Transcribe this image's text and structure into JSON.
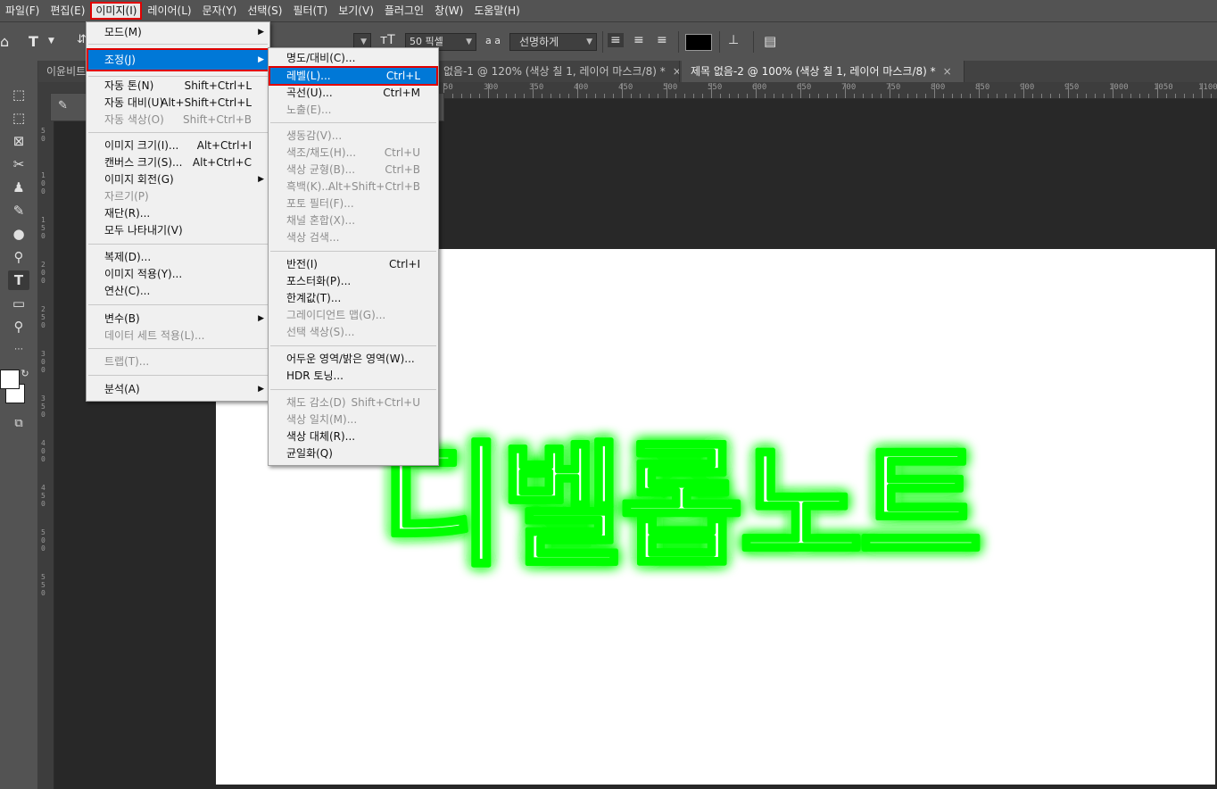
{
  "menubar": {
    "items": [
      "파일(F)",
      "편집(E)",
      "이미지(I)",
      "레이어(L)",
      "문자(Y)",
      "선택(S)",
      "필터(T)",
      "보기(V)",
      "플러그인",
      "창(W)",
      "도움말(H)"
    ]
  },
  "options": {
    "font_size": "50 픽셀",
    "aa_label": "a a",
    "antialias": "선명하게",
    "color_swatch": "#000000"
  },
  "tabs": [
    {
      "label": "이윤비트",
      "active": false
    },
    {
      "label": "없음-1 @ 120% (색상 칠 1, 레이어 마스크/8) *",
      "active": false
    },
    {
      "label": "제목 없음-2 @ 100% (색상 칠 1, 레이어 마스크/8) *",
      "active": true
    }
  ],
  "ruler": {
    "top_labels": [
      "50",
      "300",
      "350",
      "400",
      "450",
      "500",
      "550",
      "600",
      "650",
      "700",
      "750",
      "800",
      "850",
      "900",
      "950",
      "1000",
      "1050",
      "1100"
    ],
    "left_labels": [
      "50",
      "100",
      "150",
      "200",
      "250",
      "300",
      "350",
      "400",
      "450",
      "500",
      "550"
    ]
  },
  "image_menu": {
    "items": [
      {
        "label": "모드(M)",
        "shortcut": "",
        "submenu": true,
        "disabled": false
      },
      {
        "label": "조정(J)",
        "shortcut": "",
        "submenu": true,
        "disabled": false,
        "highlighted": true
      },
      {
        "label": "자동 톤(N)",
        "shortcut": "Shift+Ctrl+L",
        "disabled": false
      },
      {
        "label": "자동 대비(U)",
        "shortcut": "Alt+Shift+Ctrl+L",
        "disabled": false
      },
      {
        "label": "자동 색상(O)",
        "shortcut": "Shift+Ctrl+B",
        "disabled": true
      },
      {
        "label": "이미지 크기(I)...",
        "shortcut": "Alt+Ctrl+I",
        "disabled": false
      },
      {
        "label": "캔버스 크기(S)...",
        "shortcut": "Alt+Ctrl+C",
        "disabled": false
      },
      {
        "label": "이미지 회전(G)",
        "shortcut": "",
        "submenu": true,
        "disabled": false
      },
      {
        "label": "자르기(P)",
        "shortcut": "",
        "disabled": true
      },
      {
        "label": "재단(R)...",
        "shortcut": "",
        "disabled": false
      },
      {
        "label": "모두 나타내기(V)",
        "shortcut": "",
        "disabled": false
      },
      {
        "label": "복제(D)...",
        "shortcut": "",
        "disabled": false
      },
      {
        "label": "이미지 적용(Y)...",
        "shortcut": "",
        "disabled": false
      },
      {
        "label": "연산(C)...",
        "shortcut": "",
        "disabled": false
      },
      {
        "label": "변수(B)",
        "shortcut": "",
        "submenu": true,
        "disabled": false
      },
      {
        "label": "데이터 세트 적용(L)...",
        "shortcut": "",
        "disabled": true
      },
      {
        "label": "트랩(T)...",
        "shortcut": "",
        "disabled": true
      },
      {
        "label": "분석(A)",
        "shortcut": "",
        "submenu": true,
        "disabled": false
      }
    ]
  },
  "adjust_menu": {
    "items": [
      {
        "label": "명도/대비(C)...",
        "shortcut": "",
        "disabled": false
      },
      {
        "label": "레벨(L)...",
        "shortcut": "Ctrl+L",
        "disabled": false,
        "highlighted": true
      },
      {
        "label": "곡선(U)...",
        "shortcut": "Ctrl+M",
        "disabled": false
      },
      {
        "label": "노출(E)...",
        "shortcut": "",
        "disabled": true
      },
      {
        "label": "생동감(V)...",
        "shortcut": "",
        "disabled": true
      },
      {
        "label": "색조/채도(H)...",
        "shortcut": "Ctrl+U",
        "disabled": true
      },
      {
        "label": "색상 균형(B)...",
        "shortcut": "Ctrl+B",
        "disabled": true
      },
      {
        "label": "흑백(K)...",
        "shortcut": "Alt+Shift+Ctrl+B",
        "disabled": true
      },
      {
        "label": "포토 필터(F)...",
        "shortcut": "",
        "disabled": true
      },
      {
        "label": "채널 혼합(X)...",
        "shortcut": "",
        "disabled": true
      },
      {
        "label": "색상 검색...",
        "shortcut": "",
        "disabled": true
      },
      {
        "label": "반전(I)",
        "shortcut": "Ctrl+I",
        "disabled": false
      },
      {
        "label": "포스터화(P)...",
        "shortcut": "",
        "disabled": false
      },
      {
        "label": "한계값(T)...",
        "shortcut": "",
        "disabled": false
      },
      {
        "label": "그레이디언트 맵(G)...",
        "shortcut": "",
        "disabled": true
      },
      {
        "label": "선택 색상(S)...",
        "shortcut": "",
        "disabled": true
      },
      {
        "label": "어두운 영역/밝은 영역(W)...",
        "shortcut": "",
        "disabled": false
      },
      {
        "label": "HDR 토닝...",
        "shortcut": "",
        "disabled": false
      },
      {
        "label": "채도 감소(D)",
        "shortcut": "Shift+Ctrl+U",
        "disabled": true
      },
      {
        "label": "색상 일치(M)...",
        "shortcut": "",
        "disabled": true
      },
      {
        "label": "색상 대체(R)...",
        "shortcut": "",
        "disabled": false
      },
      {
        "label": "균일화(Q)",
        "shortcut": "",
        "disabled": false
      }
    ]
  },
  "canvas": {
    "text": "디벨롭노트",
    "glow_color": "#00ff00",
    "fill_color": "#ffffff",
    "background": "#ffffff"
  },
  "colors": {
    "fg": "#ffffff",
    "bg": "#ffffff"
  }
}
